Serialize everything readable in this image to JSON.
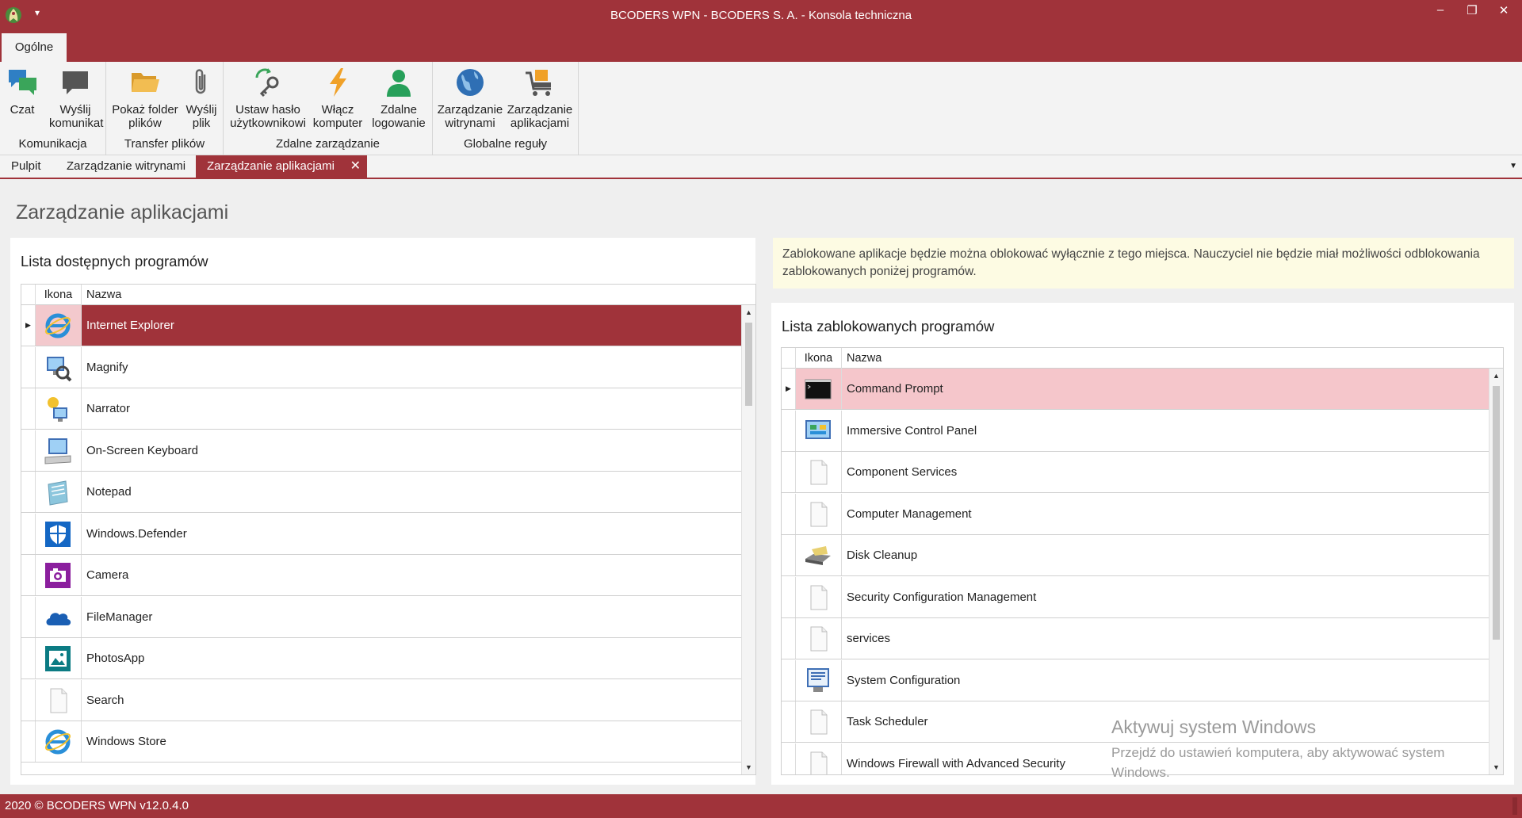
{
  "window": {
    "title": "BCODERS WPN - BCODERS S. A. - Konsola techniczna",
    "quick_access_arrow": "▾",
    "minimize": "‒",
    "restore": "❐",
    "close": "✕"
  },
  "ribbon": {
    "tab": "Ogólne",
    "groups": [
      {
        "label": "Komunikacja",
        "buttons": [
          {
            "label1": "Czat",
            "label2": "",
            "icon": "chat-icon"
          },
          {
            "label1": "Wyślij",
            "label2": "komunikat",
            "icon": "message-icon"
          }
        ]
      },
      {
        "label": "Transfer plików",
        "buttons": [
          {
            "label1": "Pokaż folder",
            "label2": "plików",
            "icon": "folder-icon"
          },
          {
            "label1": "Wyślij",
            "label2": "plik",
            "icon": "paperclip-icon"
          }
        ]
      },
      {
        "label": "Zdalne zarządzanie",
        "buttons": [
          {
            "label1": "Ustaw hasło",
            "label2": "użytkownikowi",
            "icon": "key-refresh-icon"
          },
          {
            "label1": "Włącz",
            "label2": "komputer",
            "icon": "lightning-icon"
          },
          {
            "label1": "Zdalne",
            "label2": "logowanie",
            "icon": "user-icon"
          }
        ]
      },
      {
        "label": "Globalne reguły",
        "buttons": [
          {
            "label1": "Zarządzanie",
            "label2": "witrynami",
            "icon": "globe-icon"
          },
          {
            "label1": "Zarządzanie",
            "label2": "aplikacjami",
            "icon": "cart-icon"
          }
        ]
      }
    ]
  },
  "doc_tabs": {
    "tabs": [
      "Pulpit",
      "Zarządzanie witrynami",
      "Zarządzanie aplikacjami"
    ],
    "close": "✕",
    "dropdown": "▼"
  },
  "page": {
    "title": "Zarządzanie aplikacjami"
  },
  "left_panel": {
    "title": "Lista dostępnych programów",
    "columns": {
      "icon": "Ikona",
      "name": "Nazwa"
    },
    "selected_marker": "▶",
    "rows": [
      {
        "name": "Internet Explorer",
        "icon": "internet-explorer-icon"
      },
      {
        "name": "Magnify",
        "icon": "magnify-icon"
      },
      {
        "name": "Narrator",
        "icon": "narrator-icon"
      },
      {
        "name": "On-Screen Keyboard",
        "icon": "keyboard-icon"
      },
      {
        "name": "Notepad",
        "icon": "notepad-icon"
      },
      {
        "name": "Windows.Defender",
        "icon": "defender-shield-icon"
      },
      {
        "name": "Camera",
        "icon": "camera-icon"
      },
      {
        "name": "FileManager",
        "icon": "cloud-icon"
      },
      {
        "name": "PhotosApp",
        "icon": "photos-icon"
      },
      {
        "name": "Search",
        "icon": "blank-file-icon"
      },
      {
        "name": "Windows Store",
        "icon": "internet-explorer-icon"
      }
    ]
  },
  "notice": {
    "text": "Zablokowane aplikacje będzie można oblokować wyłącznie z tego miejsca. Nauczyciel nie będzie miał możliwości odblokowania zablokowanych poniżej programów."
  },
  "right_panel": {
    "title": "Lista zablokowanych programów",
    "columns": {
      "icon": "Ikona",
      "name": "Nazwa"
    },
    "selected_marker": "▶",
    "rows": [
      {
        "name": "Command Prompt",
        "icon": "command-prompt-icon"
      },
      {
        "name": "Immersive Control Panel",
        "icon": "control-panel-icon"
      },
      {
        "name": "Component Services",
        "icon": "blank-file-icon"
      },
      {
        "name": "Computer Management",
        "icon": "blank-file-icon"
      },
      {
        "name": "Disk Cleanup",
        "icon": "disk-cleanup-icon"
      },
      {
        "name": "Security Configuration Management",
        "icon": "blank-file-icon"
      },
      {
        "name": "services",
        "icon": "blank-file-icon"
      },
      {
        "name": "System Configuration",
        "icon": "system-config-icon"
      },
      {
        "name": "Task Scheduler",
        "icon": "blank-file-icon"
      },
      {
        "name": "Windows Firewall with Advanced Security",
        "icon": "blank-file-icon"
      }
    ]
  },
  "scroll": {
    "up": "▲",
    "down": "▼"
  },
  "watermark": {
    "title": "Aktywuj system Windows",
    "subtitle": "Przejdź do ustawień komputera, aby aktywować system Windows."
  },
  "status_bar": {
    "text": "2020 ©  BCODERS WPN v12.0.4.0"
  },
  "colors": {
    "accent": "#a0333a",
    "selected_light": "#f5c6cb",
    "notice_bg": "#fdfbe3"
  }
}
